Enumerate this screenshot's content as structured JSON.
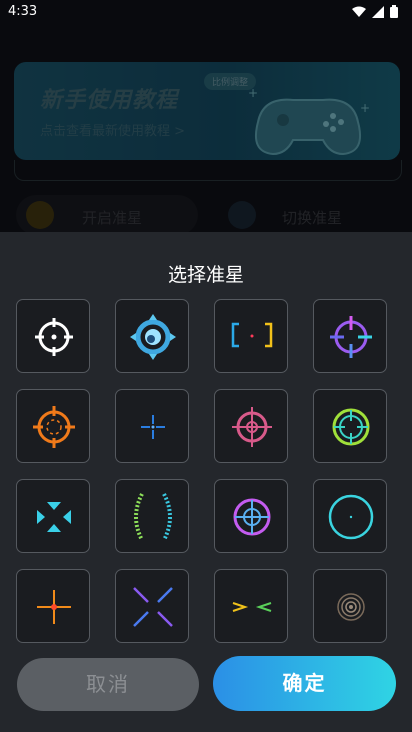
{
  "status_bar": {
    "time": "4:33"
  },
  "banner": {
    "title": "新手使用教程",
    "tag": "比例调整",
    "subtitle": "点击查看最新使用教程 >"
  },
  "app_buttons": {
    "enable": "开启准星",
    "switch": "切换准星"
  },
  "sheet": {
    "title": "选择准星",
    "crosshairs": [
      {
        "icon": "crosshair-white-circle-icon"
      },
      {
        "icon": "crosshair-blue-ring-icon"
      },
      {
        "icon": "crosshair-bracket-icon"
      },
      {
        "icon": "crosshair-gradient-circle-icon"
      },
      {
        "icon": "crosshair-orange-circle-icon"
      },
      {
        "icon": "crosshair-blue-cross-icon"
      },
      {
        "icon": "crosshair-pink-circle-icon"
      },
      {
        "icon": "crosshair-green-circle-icon"
      },
      {
        "icon": "crosshair-cyan-arrows-icon"
      },
      {
        "icon": "crosshair-green-brackets-icon"
      },
      {
        "icon": "crosshair-purple-circle-icon"
      },
      {
        "icon": "crosshair-cyan-ring-icon"
      },
      {
        "icon": "crosshair-orange-plus-icon"
      },
      {
        "icon": "crosshair-purple-x-icon"
      },
      {
        "icon": "crosshair-chevrons-icon"
      },
      {
        "icon": "crosshair-target-rings-icon"
      }
    ],
    "cancel_label": "取消",
    "confirm_label": "确定"
  }
}
